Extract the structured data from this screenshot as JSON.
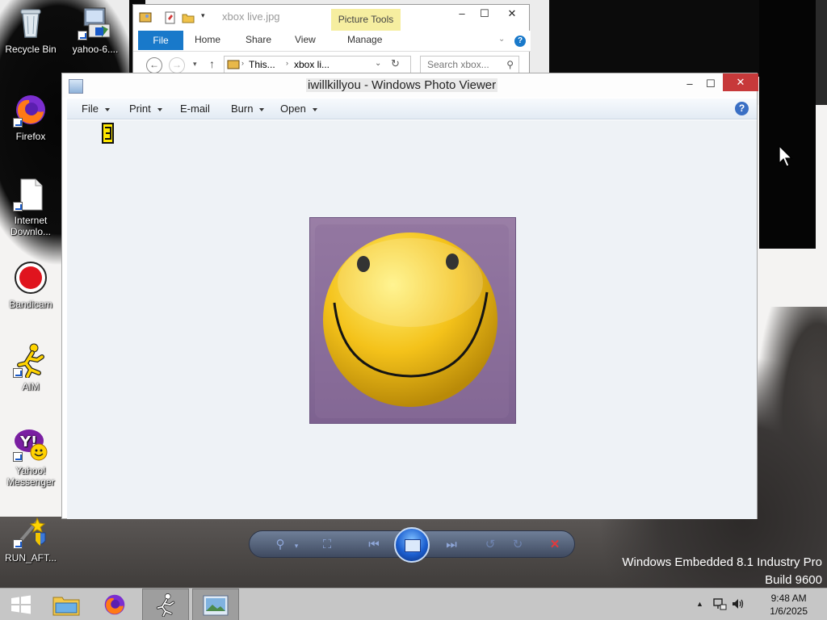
{
  "desktop": {
    "icons": [
      {
        "label": "Recycle Bin",
        "icon": "recycle-bin-icon"
      },
      {
        "label": "yahoo-6....",
        "icon": "installer-icon"
      },
      {
        "label": "Firefox",
        "icon": "firefox-icon"
      },
      {
        "label": "Internet Downlo...",
        "icon": "file-icon"
      },
      {
        "label": "Bandicam",
        "icon": "bandicam-icon"
      },
      {
        "label": "AIM",
        "icon": "aim-running-man-icon"
      },
      {
        "label": "Yahoo! Messenger",
        "icon": "yahoo-messenger-icon"
      },
      {
        "label": "RUN_AFT...",
        "icon": "shield-wand-icon"
      }
    ]
  },
  "explorer": {
    "title": "xbox live.jpg",
    "context_tab": "Picture Tools",
    "tabs": [
      "File",
      "Home",
      "Share",
      "View",
      "Manage"
    ],
    "address": [
      "This...",
      "xbox li..."
    ],
    "search_placeholder": "Search xbox..."
  },
  "viewer": {
    "title": "iwillkillyou - Windows Photo Viewer",
    "menu": [
      {
        "label": "File",
        "has_caret": true
      },
      {
        "label": "Print",
        "has_caret": true
      },
      {
        "label": "E-mail",
        "has_caret": false
      },
      {
        "label": "Burn",
        "has_caret": true
      },
      {
        "label": "Open",
        "has_caret": true
      }
    ],
    "help": "?",
    "photo_subject": "smiley-face"
  },
  "watermark": {
    "line1": "Windows Embedded 8.1 Industry Pro",
    "line2": "Build 9600"
  },
  "taskbar": {
    "time": "9:48 AM",
    "date": "1/6/2025",
    "buttons": [
      "start",
      "file-explorer",
      "firefox",
      "aim",
      "photo-viewer"
    ]
  },
  "colors": {
    "accent": "#1979ca",
    "close_red": "#c7393a",
    "picture_tools": "#f6eea0"
  }
}
